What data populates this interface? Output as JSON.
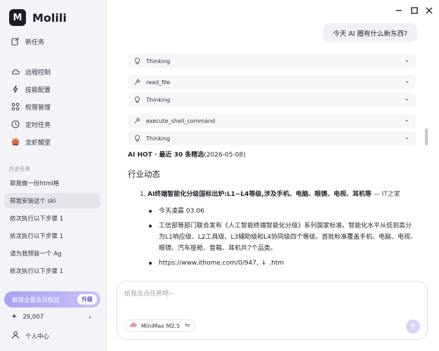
{
  "app": {
    "logo_text": "M",
    "name": "Molili"
  },
  "nav": {
    "new_task": "新任务",
    "remote": "远程控制",
    "skills": "技能配置",
    "permissions": "权限管理",
    "scheduled": "定时任务",
    "lobster": "龙虾鲷堂"
  },
  "history": {
    "label": "历史任务",
    "items": [
      "帮我做一份html格",
      "帮我安装这个 ski",
      "依次执行以下步骤 1",
      "依次执行以下步骤 1",
      "请为我预装一个 Ag",
      "依次执行以下步骤 1"
    ]
  },
  "vip": {
    "label": "解锁全量会员权益",
    "button": "升级"
  },
  "credits": {
    "value": "29,007"
  },
  "user": {
    "label": "个人中心"
  },
  "chat": {
    "user_message": "今天 AI 圈有什么新东西?",
    "tools": [
      {
        "icon": "lightbulb-icon",
        "label": "Thinking"
      },
      {
        "icon": "tool-icon",
        "label": "read_file"
      },
      {
        "icon": "lightbulb-icon",
        "label": "Thinking"
      },
      {
        "icon": "tool-icon",
        "label": "execute_shell_command"
      },
      {
        "icon": "lightbulb-icon",
        "label": "Thinking"
      }
    ],
    "headline_bold": "AI HOT · 最近 30 条精选",
    "headline_date": "(2026-05-08)",
    "section_title": "行业动态",
    "item1_num": "1.",
    "item1_title": "AI终端智能化分级国标出炉:L1~L4等级,涉及手机、电脑、眼镜、电视、耳机等",
    "item1_source": " — IT之家",
    "bullet1": "今天凌晨 03:06",
    "bullet2": "工信部等部门联合发布《人工智能终端智能化分级》系列国家标准。智能化水平从低到高分为L1响应级、L2工具级、L3辅助级和L4协同级四个等级。首批标准覆盖手机、电脑、电视、眼镜、汽车座舱、音箱、耳机共7个品类。",
    "bullet3_prefix": "https://www.ithome.com/0/947,",
    "bullet3_suffix": ".htm"
  },
  "input": {
    "placeholder": "给我派点任务吧~",
    "model": "MiniMax M2.5"
  }
}
